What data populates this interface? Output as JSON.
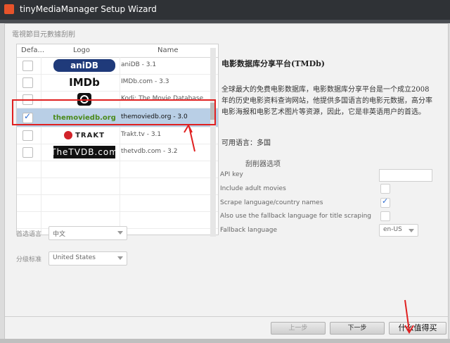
{
  "window": {
    "title": "tinyMediaManager Setup Wizard"
  },
  "section_title": "電視節目元數據刮削",
  "table": {
    "headers": {
      "default": "Defa...",
      "logo": "Logo",
      "name": "Name"
    },
    "rows": [
      {
        "checked": false,
        "logo_text": "aniDB",
        "logo_icon": "anidb-logo",
        "name": "aniDB - 3.1",
        "selected": false
      },
      {
        "checked": false,
        "logo_text": "IMDb",
        "logo_icon": "imdb-logo",
        "name": "IMDb.com - 3.3",
        "selected": false
      },
      {
        "checked": false,
        "logo_text": "",
        "logo_icon": "kodi-logo",
        "name": "Kodi: The Movie Database",
        "selected": false
      },
      {
        "checked": true,
        "logo_text": "themoviedb.org",
        "logo_icon": "tmdb-logo",
        "name": "themoviedb.org - 3.0",
        "selected": true
      },
      {
        "checked": false,
        "logo_text": "TRAKT",
        "logo_icon": "trakt-logo",
        "name": "Trakt.tv - 3.1",
        "selected": false
      },
      {
        "checked": false,
        "logo_text": "TheTVDB.com",
        "logo_icon": "tvdb-logo",
        "name": "thetvdb.com - 3.2",
        "selected": false
      }
    ]
  },
  "preferred_language": {
    "label": "首选语言",
    "value": "中文"
  },
  "rating_standard": {
    "label": "分级标准",
    "value": "United States"
  },
  "detail": {
    "title": "电影数据库分享平台(TMDb)",
    "description": "全球最大的免费电影数据库，电影数据库分享平台是一个成立2008年的历史电影资料查询网站，他提供多国语言的电影元数据，高分率电影海报和电影艺术图片等资源，因此，它是非英语用户的首选。",
    "languages": "可用语言：多国"
  },
  "scraper_options": {
    "title": "刮削器选项",
    "api_key_label": "API key",
    "api_key_value": "",
    "include_adult_label": "Include adult movies",
    "include_adult_checked": false,
    "scrape_names_label": "Scrape language/country names",
    "scrape_names_checked": true,
    "fallback_title_label": "Also use the fallback language for title scraping",
    "fallback_title_checked": false,
    "fallback_lang_label": "Fallback language",
    "fallback_lang_value": "en-US"
  },
  "buttons": {
    "back": "上一步",
    "next": "下一步",
    "finish": "什么值得买"
  },
  "colors": {
    "annotation": "#e02020",
    "selection": "#b9cfe6",
    "titlebar": "#2f3236"
  }
}
